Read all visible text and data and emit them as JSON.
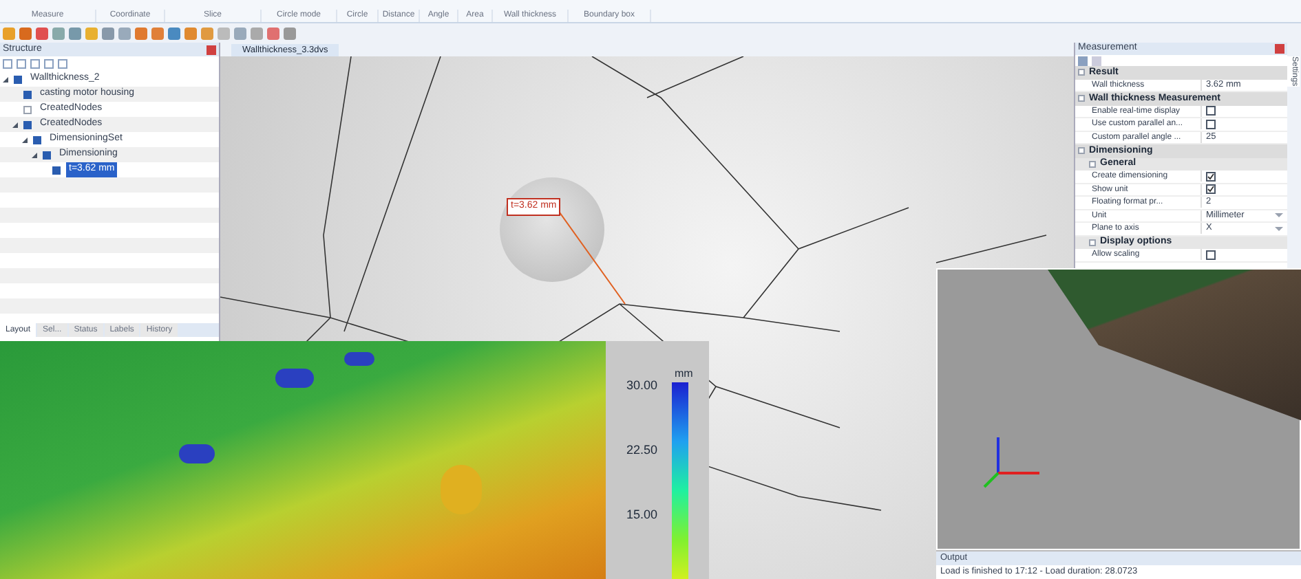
{
  "ribbon": {
    "groups": [
      "Measure",
      "Coordinate",
      "Slice",
      "Circle mode",
      "Circle",
      "Distance",
      "Angle",
      "Area",
      "Wall thickness",
      "Boundary box"
    ]
  },
  "structure": {
    "title": "Structure",
    "tree": [
      {
        "label": "Wallthickness_2",
        "checked": true,
        "selected": false,
        "children": [
          {
            "label": "casting motor housing",
            "checked": true,
            "selected": false
          },
          {
            "label": "CreatedNodes",
            "checked": false,
            "selected": false
          },
          {
            "label": "CreatedNodes",
            "checked": true,
            "selected": false,
            "children": [
              {
                "label": "DimensioningSet",
                "checked": true,
                "selected": false,
                "children": [
                  {
                    "label": "Dimensioning",
                    "checked": true,
                    "selected": false,
                    "children": [
                      {
                        "label": "t=3.62 mm",
                        "checked": true,
                        "selected": true
                      }
                    ]
                  }
                ]
              }
            ]
          }
        ]
      }
    ],
    "tabs": [
      {
        "label": "Layout",
        "selected": true
      },
      {
        "label": "Sel...",
        "selected": false
      },
      {
        "label": "Status",
        "selected": false
      },
      {
        "label": "Labels",
        "selected": false
      },
      {
        "label": "History",
        "selected": false
      }
    ]
  },
  "viewport": {
    "tab": "Wallthickness_3.3dvs",
    "measurement_label": "t=3.62 mm"
  },
  "measurement": {
    "title": "Measurement",
    "rows": [
      {
        "kind": "group",
        "label": "Result"
      },
      {
        "kind": "text",
        "label": "Wall thickness",
        "value": "3.62 mm"
      },
      {
        "kind": "group",
        "label": "Wall thickness Measurement"
      },
      {
        "kind": "checkbox",
        "label": "Enable real-time display",
        "checked": false
      },
      {
        "kind": "checkbox",
        "label": "Use custom parallel an...",
        "checked": false
      },
      {
        "kind": "text",
        "label": "Custom parallel angle ...",
        "value": "25"
      },
      {
        "kind": "group",
        "label": "Dimensioning"
      },
      {
        "kind": "subgroup",
        "label": "General"
      },
      {
        "kind": "checkbox",
        "label": "Create dimensioning",
        "checked": true
      },
      {
        "kind": "checkbox",
        "label": "Show unit",
        "checked": true
      },
      {
        "kind": "text",
        "label": "Floating format pr...",
        "value": "2"
      },
      {
        "kind": "dropdown",
        "label": "Unit",
        "value": "Millimeter"
      },
      {
        "kind": "dropdown",
        "label": "Plane to axis",
        "value": "X"
      },
      {
        "kind": "subgroup",
        "label": "Display options"
      },
      {
        "kind": "checkbox",
        "label": "Allow scaling",
        "checked": false
      }
    ]
  },
  "side_tab": "Settings",
  "color_scale": {
    "unit": "mm",
    "labels": [
      "30.00",
      "22.50",
      "15.00"
    ]
  },
  "output": {
    "title": "Output",
    "message": "Load is finished to 17:12 - Load duration: 28.0723"
  }
}
